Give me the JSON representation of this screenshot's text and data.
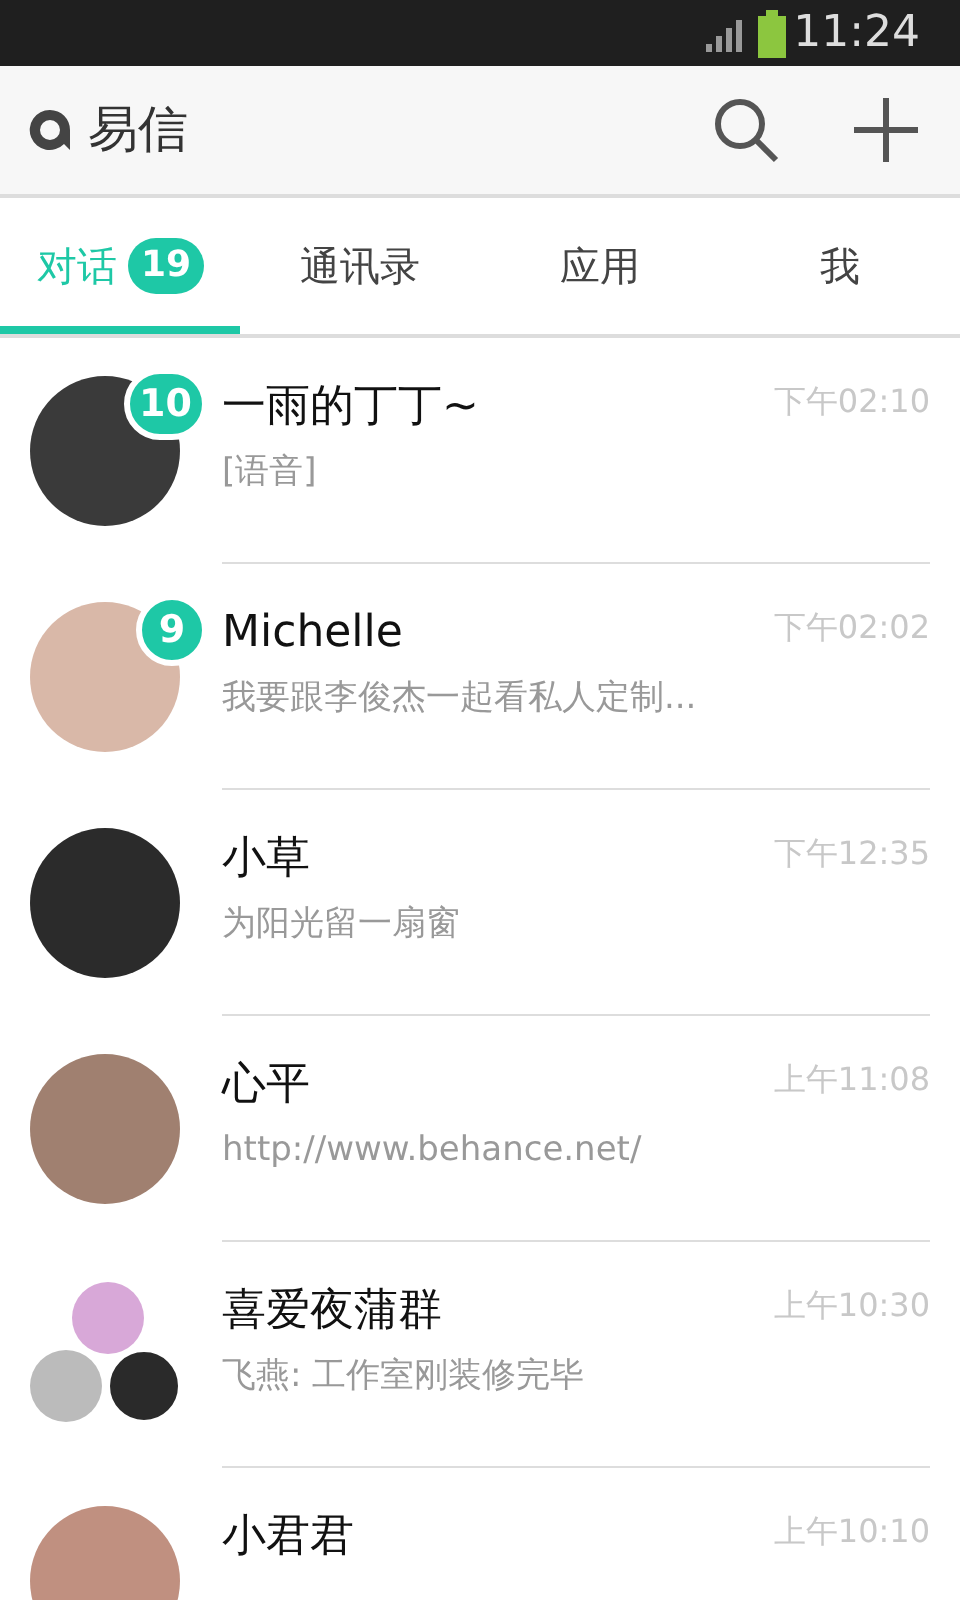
{
  "status_bar": {
    "time": "11:24"
  },
  "app_bar": {
    "title": "易信"
  },
  "tabs": [
    {
      "label": "对话",
      "badge": "19",
      "selected": true
    },
    {
      "label": "通讯录",
      "selected": false
    },
    {
      "label": "应用",
      "selected": false
    },
    {
      "label": "我",
      "selected": false
    }
  ],
  "conversations": [
    {
      "kind": "single",
      "name": "一雨的丁丁~",
      "preview": "[语音]",
      "time": "下午02:10",
      "unread": "10"
    },
    {
      "kind": "single",
      "name": "Michelle",
      "preview": "我要跟李俊杰一起看私人定制...",
      "time": "下午02:02",
      "unread": "9"
    },
    {
      "kind": "single",
      "name": "小草",
      "preview": "为阳光留一扇窗",
      "time": "下午12:35"
    },
    {
      "kind": "single",
      "name": "心平",
      "preview": "http://www.behance.net/",
      "time": "上午11:08"
    },
    {
      "kind": "group",
      "name": "喜爱夜蒲群",
      "preview": "飞燕: 工作室刚装修完毕",
      "time": "上午10:30"
    },
    {
      "kind": "single",
      "name": "小君君",
      "time": "上午10:10"
    }
  ]
}
